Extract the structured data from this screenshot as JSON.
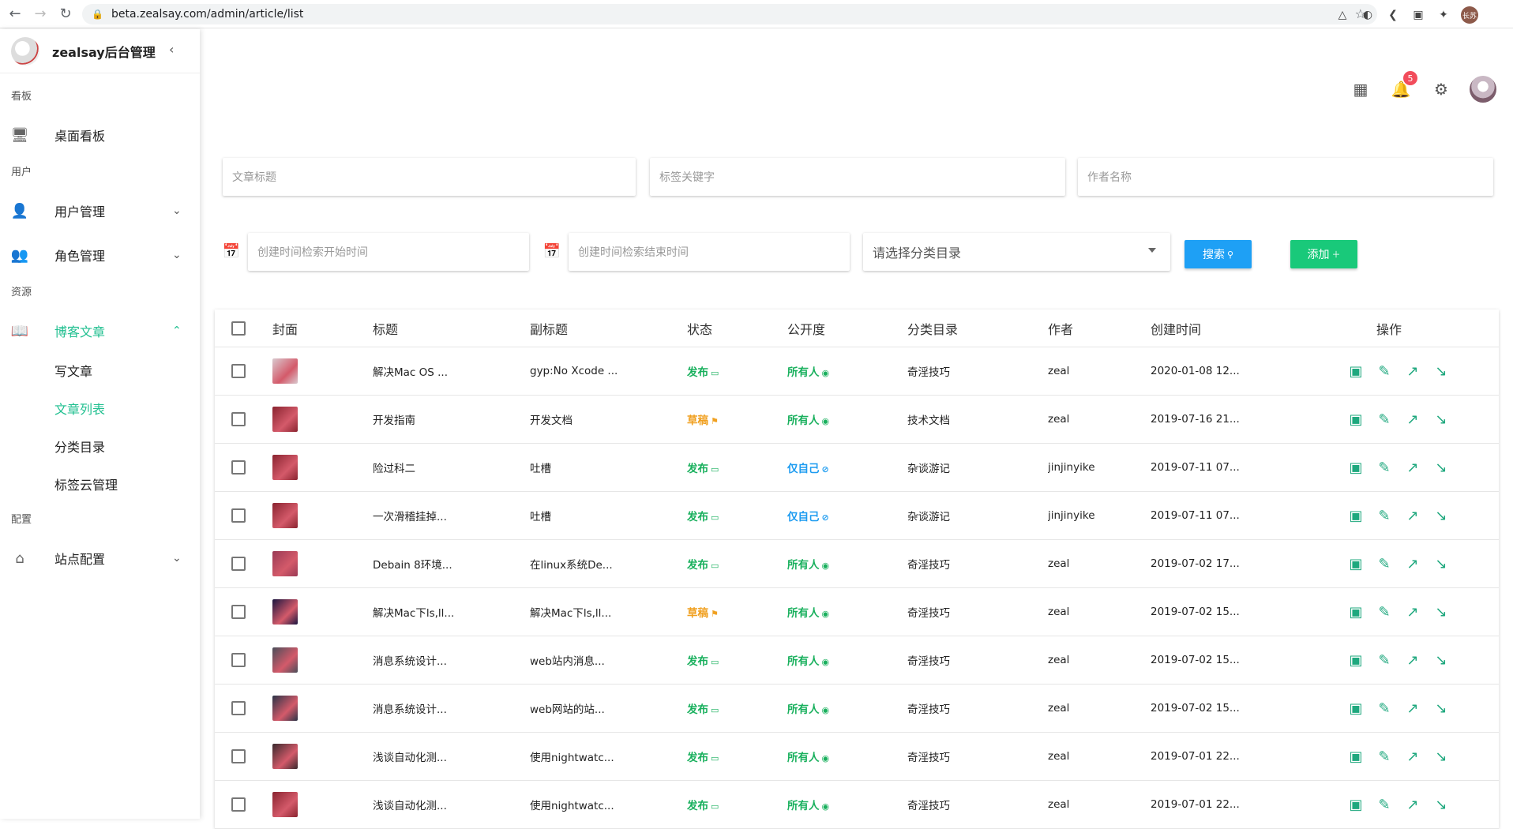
{
  "browser": {
    "url": "beta.zealsay.com/admin/article/list",
    "back": "←",
    "forward": "→",
    "reload": "↻",
    "avatar_text": "长苏"
  },
  "sidebar": {
    "brand_title": "zealsay后台管理",
    "sections": {
      "board": "看板",
      "user": "用户",
      "resource": "资源",
      "config": "配置"
    },
    "items": {
      "dashboard": "桌面看板",
      "user_mgmt": "用户管理",
      "role_mgmt": "角色管理",
      "blog": "博客文章",
      "site_config": "站点配置"
    },
    "blog_sub": {
      "write": "写文章",
      "list": "文章列表",
      "category": "分类目录",
      "tags": "标签云管理"
    }
  },
  "toolbar": {
    "notification_count": "5"
  },
  "filters": {
    "title_placeholder": "文章标题",
    "tag_placeholder": "标签关键字",
    "author_placeholder": "作者名称",
    "start_placeholder": "创建时间检索开始时间",
    "end_placeholder": "创建时间检索结束时间",
    "category_placeholder": "请选择分类目录",
    "search_label": "搜索",
    "add_label": "添加"
  },
  "table": {
    "headers": [
      "封面",
      "标题",
      "副标题",
      "状态",
      "公开度",
      "分类目录",
      "作者",
      "创建时间",
      "操作"
    ],
    "rows": [
      {
        "title": "解决Mac OS ...",
        "subtitle": "gyp:No Xcode ...",
        "status": "发布",
        "visibility": "所有人",
        "category": "奇淫技巧",
        "author": "zeal",
        "created": "2020-01-08 12...",
        "thumb": "#d9c9cf"
      },
      {
        "title": "开发指南",
        "subtitle": "开发文档",
        "status": "草稿",
        "visibility": "所有人",
        "category": "技术文档",
        "author": "zeal",
        "created": "2019-07-16 21...",
        "thumb": "#8a2430"
      },
      {
        "title": "险过科二",
        "subtitle": "吐槽",
        "status": "发布",
        "visibility": "仅自己",
        "category": "杂谈游记",
        "author": "jinjinyike",
        "created": "2019-07-11 07...",
        "thumb": "#8a2430"
      },
      {
        "title": "一次滑稽挂掉...",
        "subtitle": "吐槽",
        "status": "发布",
        "visibility": "仅自己",
        "category": "杂谈游记",
        "author": "jinjinyike",
        "created": "2019-07-11 07...",
        "thumb": "#8a2430"
      },
      {
        "title": "Debain 8环境...",
        "subtitle": "在linux系统De...",
        "status": "发布",
        "visibility": "所有人",
        "category": "奇淫技巧",
        "author": "zeal",
        "created": "2019-07-02 17...",
        "thumb": "#9a3a55"
      },
      {
        "title": "解决Mac下ls,ll...",
        "subtitle": "解决Mac下ls,ll...",
        "status": "草稿",
        "visibility": "所有人",
        "category": "奇淫技巧",
        "author": "zeal",
        "created": "2019-07-02 15...",
        "thumb": "#1a1640"
      },
      {
        "title": "消息系统设计...",
        "subtitle": "web站内消息...",
        "status": "发布",
        "visibility": "所有人",
        "category": "奇淫技巧",
        "author": "zeal",
        "created": "2019-07-02 15...",
        "thumb": "#4a4e5a"
      },
      {
        "title": "消息系统设计...",
        "subtitle": "web网站的站...",
        "status": "发布",
        "visibility": "所有人",
        "category": "奇淫技巧",
        "author": "zeal",
        "created": "2019-07-02 15...",
        "thumb": "#2a3448"
      },
      {
        "title": "浅谈自动化测...",
        "subtitle": "使用nightwatc...",
        "status": "发布",
        "visibility": "所有人",
        "category": "奇淫技巧",
        "author": "zeal",
        "created": "2019-07-01 22...",
        "thumb": "#3a2a2e"
      },
      {
        "title": "浅谈自动化测...",
        "subtitle": "使用nightwatc...",
        "status": "发布",
        "visibility": "所有人",
        "category": "奇淫技巧",
        "author": "zeal",
        "created": "2019-07-01 22...",
        "thumb": "#8a2430"
      }
    ]
  },
  "colors": {
    "accent": "#1fbf8f",
    "published": "#19b05d",
    "draft": "#f0a020",
    "private": "#1e9cf0",
    "search_button": "#1ea0f5",
    "add_button": "#19c97a"
  }
}
